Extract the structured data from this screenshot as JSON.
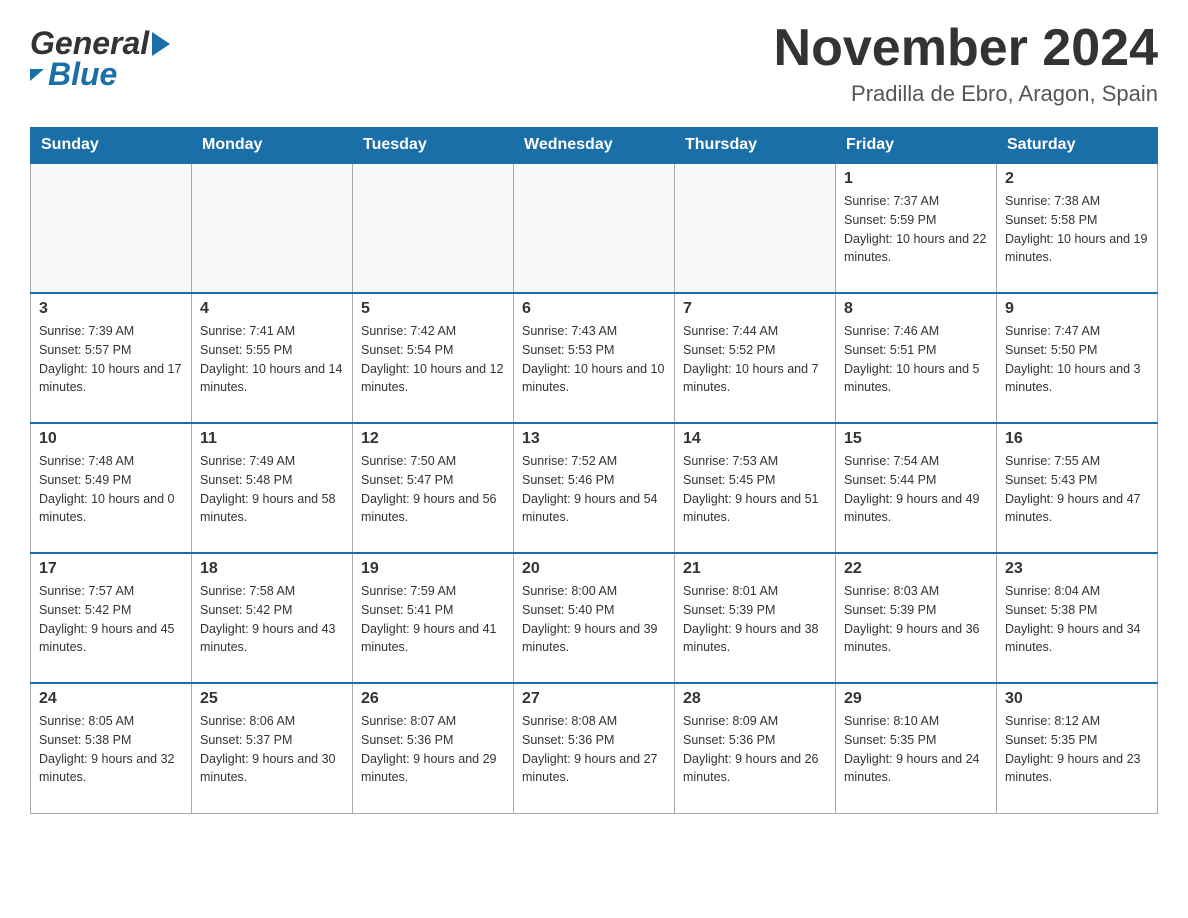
{
  "header": {
    "logo": {
      "general": "General",
      "blue": "Blue"
    },
    "title": "November 2024",
    "location": "Pradilla de Ebro, Aragon, Spain"
  },
  "weekdays": [
    "Sunday",
    "Monday",
    "Tuesday",
    "Wednesday",
    "Thursday",
    "Friday",
    "Saturday"
  ],
  "weeks": [
    [
      {
        "day": "",
        "info": ""
      },
      {
        "day": "",
        "info": ""
      },
      {
        "day": "",
        "info": ""
      },
      {
        "day": "",
        "info": ""
      },
      {
        "day": "",
        "info": ""
      },
      {
        "day": "1",
        "info": "Sunrise: 7:37 AM\nSunset: 5:59 PM\nDaylight: 10 hours and 22 minutes."
      },
      {
        "day": "2",
        "info": "Sunrise: 7:38 AM\nSunset: 5:58 PM\nDaylight: 10 hours and 19 minutes."
      }
    ],
    [
      {
        "day": "3",
        "info": "Sunrise: 7:39 AM\nSunset: 5:57 PM\nDaylight: 10 hours and 17 minutes."
      },
      {
        "day": "4",
        "info": "Sunrise: 7:41 AM\nSunset: 5:55 PM\nDaylight: 10 hours and 14 minutes."
      },
      {
        "day": "5",
        "info": "Sunrise: 7:42 AM\nSunset: 5:54 PM\nDaylight: 10 hours and 12 minutes."
      },
      {
        "day": "6",
        "info": "Sunrise: 7:43 AM\nSunset: 5:53 PM\nDaylight: 10 hours and 10 minutes."
      },
      {
        "day": "7",
        "info": "Sunrise: 7:44 AM\nSunset: 5:52 PM\nDaylight: 10 hours and 7 minutes."
      },
      {
        "day": "8",
        "info": "Sunrise: 7:46 AM\nSunset: 5:51 PM\nDaylight: 10 hours and 5 minutes."
      },
      {
        "day": "9",
        "info": "Sunrise: 7:47 AM\nSunset: 5:50 PM\nDaylight: 10 hours and 3 minutes."
      }
    ],
    [
      {
        "day": "10",
        "info": "Sunrise: 7:48 AM\nSunset: 5:49 PM\nDaylight: 10 hours and 0 minutes."
      },
      {
        "day": "11",
        "info": "Sunrise: 7:49 AM\nSunset: 5:48 PM\nDaylight: 9 hours and 58 minutes."
      },
      {
        "day": "12",
        "info": "Sunrise: 7:50 AM\nSunset: 5:47 PM\nDaylight: 9 hours and 56 minutes."
      },
      {
        "day": "13",
        "info": "Sunrise: 7:52 AM\nSunset: 5:46 PM\nDaylight: 9 hours and 54 minutes."
      },
      {
        "day": "14",
        "info": "Sunrise: 7:53 AM\nSunset: 5:45 PM\nDaylight: 9 hours and 51 minutes."
      },
      {
        "day": "15",
        "info": "Sunrise: 7:54 AM\nSunset: 5:44 PM\nDaylight: 9 hours and 49 minutes."
      },
      {
        "day": "16",
        "info": "Sunrise: 7:55 AM\nSunset: 5:43 PM\nDaylight: 9 hours and 47 minutes."
      }
    ],
    [
      {
        "day": "17",
        "info": "Sunrise: 7:57 AM\nSunset: 5:42 PM\nDaylight: 9 hours and 45 minutes."
      },
      {
        "day": "18",
        "info": "Sunrise: 7:58 AM\nSunset: 5:42 PM\nDaylight: 9 hours and 43 minutes."
      },
      {
        "day": "19",
        "info": "Sunrise: 7:59 AM\nSunset: 5:41 PM\nDaylight: 9 hours and 41 minutes."
      },
      {
        "day": "20",
        "info": "Sunrise: 8:00 AM\nSunset: 5:40 PM\nDaylight: 9 hours and 39 minutes."
      },
      {
        "day": "21",
        "info": "Sunrise: 8:01 AM\nSunset: 5:39 PM\nDaylight: 9 hours and 38 minutes."
      },
      {
        "day": "22",
        "info": "Sunrise: 8:03 AM\nSunset: 5:39 PM\nDaylight: 9 hours and 36 minutes."
      },
      {
        "day": "23",
        "info": "Sunrise: 8:04 AM\nSunset: 5:38 PM\nDaylight: 9 hours and 34 minutes."
      }
    ],
    [
      {
        "day": "24",
        "info": "Sunrise: 8:05 AM\nSunset: 5:38 PM\nDaylight: 9 hours and 32 minutes."
      },
      {
        "day": "25",
        "info": "Sunrise: 8:06 AM\nSunset: 5:37 PM\nDaylight: 9 hours and 30 minutes."
      },
      {
        "day": "26",
        "info": "Sunrise: 8:07 AM\nSunset: 5:36 PM\nDaylight: 9 hours and 29 minutes."
      },
      {
        "day": "27",
        "info": "Sunrise: 8:08 AM\nSunset: 5:36 PM\nDaylight: 9 hours and 27 minutes."
      },
      {
        "day": "28",
        "info": "Sunrise: 8:09 AM\nSunset: 5:36 PM\nDaylight: 9 hours and 26 minutes."
      },
      {
        "day": "29",
        "info": "Sunrise: 8:10 AM\nSunset: 5:35 PM\nDaylight: 9 hours and 24 minutes."
      },
      {
        "day": "30",
        "info": "Sunrise: 8:12 AM\nSunset: 5:35 PM\nDaylight: 9 hours and 23 minutes."
      }
    ]
  ]
}
